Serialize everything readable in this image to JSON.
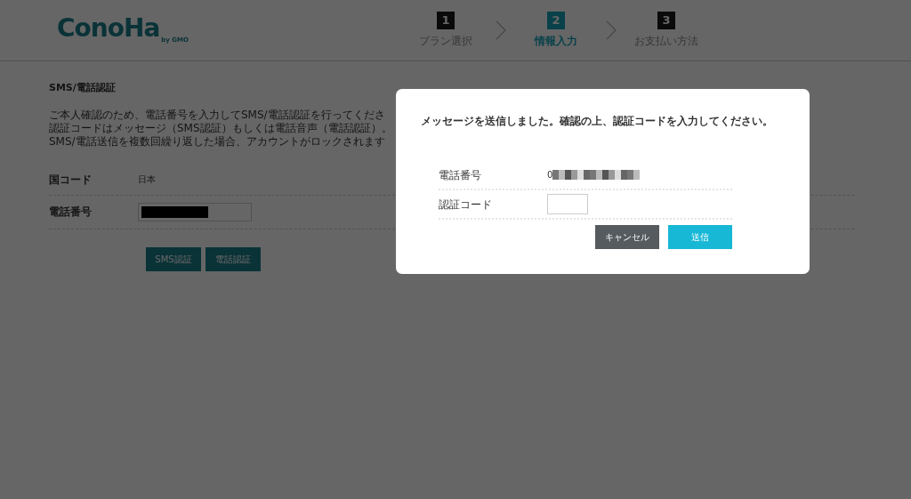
{
  "logo": {
    "name": "ConoHa",
    "tagline": "by GMO"
  },
  "steps": [
    {
      "number": "1",
      "label": "プラン選択",
      "selected": false
    },
    {
      "number": "2",
      "label": "情報入力",
      "selected": true
    },
    {
      "number": "3",
      "label": "お支払い方法",
      "selected": false
    }
  ],
  "page": {
    "title": "SMS/電話認証",
    "description": [
      "ご本人確認のため、電話番号を入力してSMS/電話認証を行ってくださ",
      "認証コードはメッセージ（SMS認証）もしくは電話音声（電話認証）。",
      "SMS/電話送信を複数回繰り返した場合、アカウントがロックされます"
    ],
    "fields": [
      {
        "label": "国コード",
        "value": "日本",
        "kind": "text"
      },
      {
        "label": "電話番号",
        "kind": "redacted-input"
      }
    ],
    "buttons": [
      "SMS認証",
      "電話認証"
    ]
  },
  "modal": {
    "message": "メッセージを送信しました。確認の上、認証コードを入力してください。",
    "rows": [
      {
        "label": "電話番号",
        "value": "0",
        "kind": "redacted-text"
      },
      {
        "label": "認証コード",
        "kind": "input"
      }
    ],
    "buttons": [
      {
        "label": "キャンセル",
        "kind": "secondary"
      },
      {
        "label": "送信",
        "kind": "primary"
      }
    ]
  }
}
